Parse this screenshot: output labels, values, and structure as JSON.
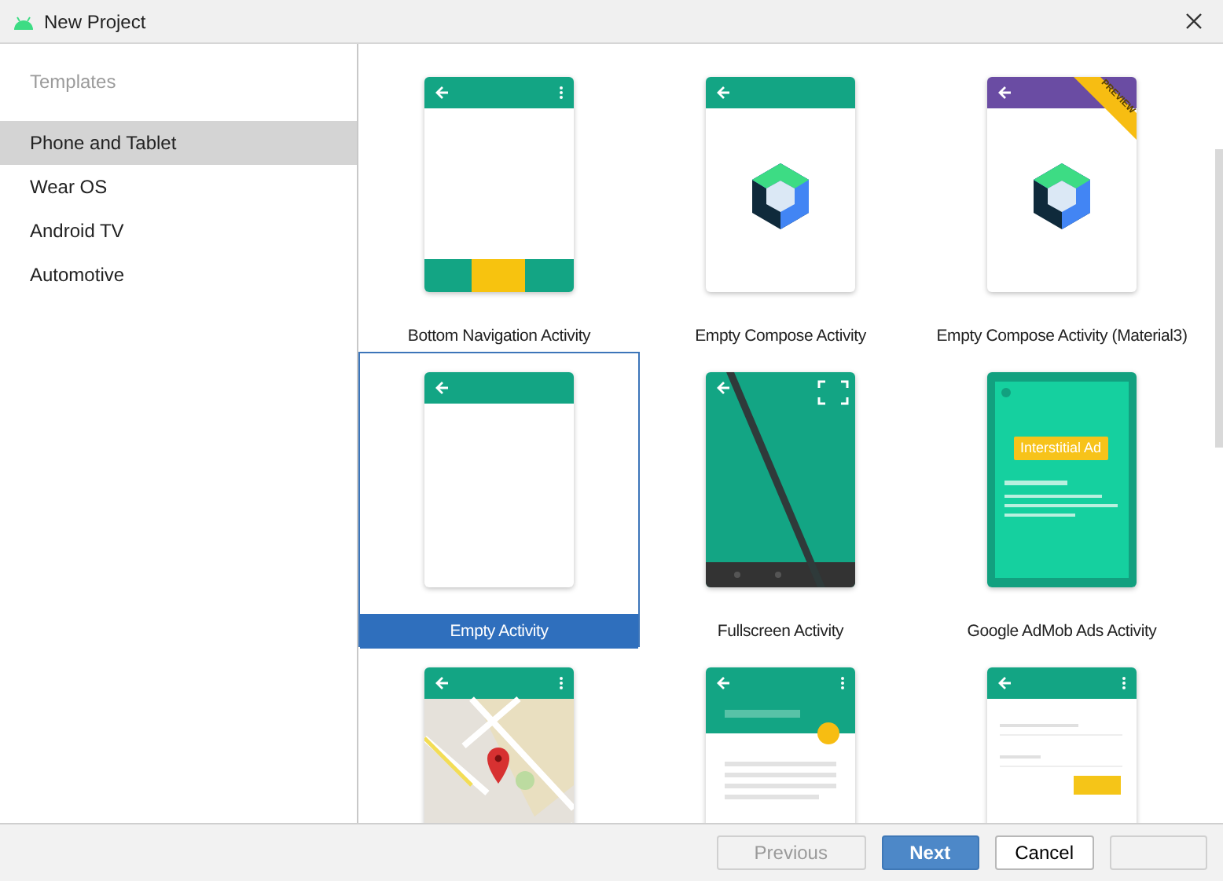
{
  "window": {
    "title": "New Project"
  },
  "sidebar": {
    "heading": "Templates",
    "items": [
      {
        "label": "Phone and Tablet",
        "selected": true
      },
      {
        "label": "Wear OS",
        "selected": false
      },
      {
        "label": "Android TV",
        "selected": false
      },
      {
        "label": "Automotive",
        "selected": false
      }
    ]
  },
  "templates": [
    {
      "kind": "bottom_nav",
      "name": "Bottom Navigation Activity",
      "selected": false
    },
    {
      "kind": "compose",
      "name": "Empty Compose Activity",
      "selected": false
    },
    {
      "kind": "compose_m3",
      "name": "Empty Compose Activity (Material3)",
      "badge": "PREVIEW",
      "selected": false
    },
    {
      "kind": "empty",
      "name": "Empty Activity",
      "selected": true
    },
    {
      "kind": "fullscreen",
      "name": "Fullscreen Activity",
      "selected": false
    },
    {
      "kind": "admob",
      "name": "Google AdMob Ads Activity",
      "ad_label": "Interstitial Ad",
      "selected": false
    },
    {
      "kind": "maps",
      "selected": false
    },
    {
      "kind": "scrolling",
      "selected": false
    },
    {
      "kind": "login",
      "selected": false
    }
  ],
  "buttons": [
    {
      "label": "Previous",
      "kind": "disabled"
    },
    {
      "label": "Next",
      "kind": "primary"
    },
    {
      "label": "Cancel",
      "kind": "default"
    },
    {
      "kind": "disabled"
    }
  ]
}
